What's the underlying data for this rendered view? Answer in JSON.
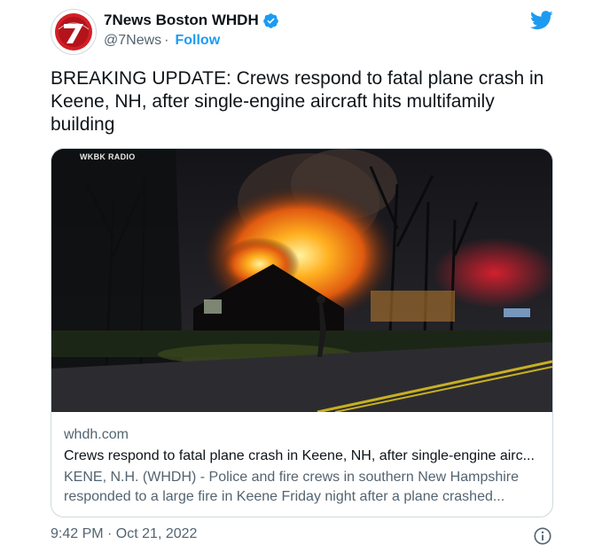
{
  "author": {
    "display_name": "7News Boston WHDH",
    "handle": "@7News",
    "separator": "·",
    "follow_label": "Follow",
    "verified_icon": "verified-badge-icon",
    "avatar_text": "7"
  },
  "tweet": {
    "text": "BREAKING UPDATE: Crews respond to fatal plane crash in Keene, NH, after single-engine aircraft hits multifamily building"
  },
  "card": {
    "image_watermark": "WKBK RADIO",
    "domain": "whdh.com",
    "title": "Crews respond to fatal plane crash in Keene, NH, after single-engine airc...",
    "description": "KENE, N.H. (WHDH) - Police and fire crews in southern New Hampshire responded to a large fire in Keene Friday night after a plane crashed..."
  },
  "footer": {
    "timestamp": "9:42 PM · Oct 21, 2022"
  },
  "colors": {
    "brand_blue": "#1d9bf0",
    "avatar_red": "#d21f26",
    "text_primary": "#0f1419",
    "text_secondary": "#536471",
    "border": "#cfd9de"
  }
}
